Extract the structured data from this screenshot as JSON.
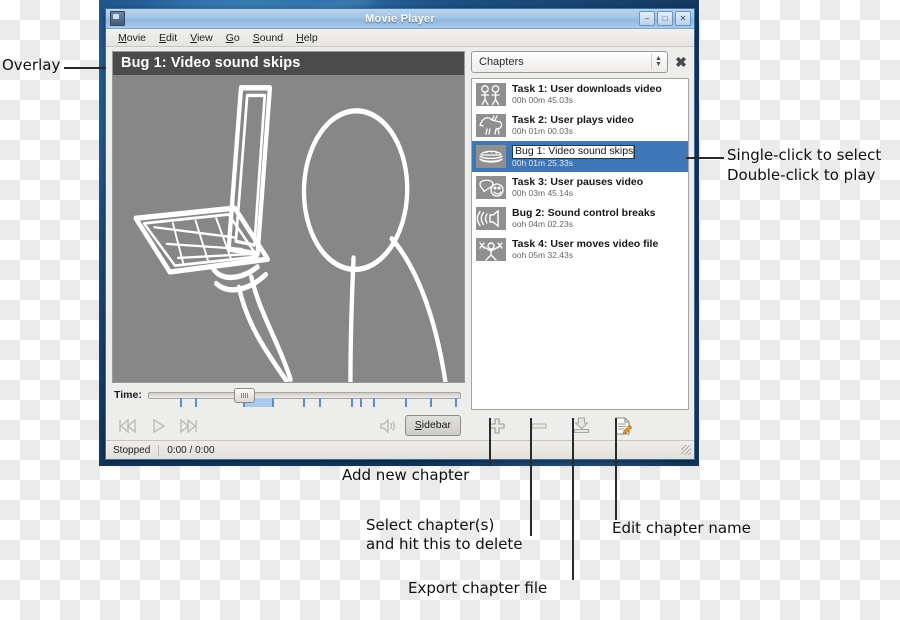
{
  "window": {
    "title": "Movie Player",
    "icon": "movie-player-icon",
    "buttons": {
      "minimize": "–",
      "maximize": "□",
      "close": "✕"
    }
  },
  "menubar": {
    "items": [
      {
        "label": "Movie",
        "mnemonic": "M"
      },
      {
        "label": "Edit",
        "mnemonic": "E"
      },
      {
        "label": "View",
        "mnemonic": "V"
      },
      {
        "label": "Go",
        "mnemonic": "G"
      },
      {
        "label": "Sound",
        "mnemonic": "S"
      },
      {
        "label": "Help",
        "mnemonic": "H"
      }
    ]
  },
  "video": {
    "overlay_title": "Bug 1: Video sound skips",
    "sketch_name": "person-holding-laptop-sketch",
    "background_color": "#878787",
    "overlay_color": "#4b4b4b"
  },
  "transport": {
    "time_label": "Time:",
    "slider_value_percent": 30,
    "fill_start_percent": 30,
    "fill_end_percent": 39,
    "tick_positions": [
      10,
      15,
      30,
      39,
      49,
      54,
      64,
      67,
      71,
      81,
      89,
      97
    ],
    "previous_label": "previous-chapter",
    "play_label": "play",
    "next_label": "next-chapter",
    "volume_label": "volume",
    "sidebar_button": "Sidebar",
    "sidebar_mnemonic": "S"
  },
  "sidebar": {
    "selector_value": "Chapters",
    "close_label": "✖",
    "chapters": [
      {
        "title": "Task 1: User downloads video",
        "time": "00h 00m 45.03s",
        "thumb": "two-stick-figures-sketch",
        "selected": false,
        "editing": false
      },
      {
        "title": "Task 2: User plays video",
        "time": "00h 01m 00.03s",
        "thumb": "horse-sketch",
        "selected": false,
        "editing": false
      },
      {
        "title": "Bug 1: Video sound skips",
        "time": "00h 01m 25.33s",
        "thumb": "hamburger-sketch",
        "selected": true,
        "editing": true
      },
      {
        "title": "Task 3: User pauses video",
        "time": "00h 03m 45.14s",
        "thumb": "speech-bubble-smiley-sketch",
        "selected": false,
        "editing": false
      },
      {
        "title": "Bug 2: Sound control breaks",
        "time": "ooh 04m 02.23s",
        "thumb": "speaker-sound-sketch",
        "selected": false,
        "editing": false
      },
      {
        "title": "Task 4: User moves video file",
        "time": "ooh 05m 32.43s",
        "thumb": "stick-figure-arms-sketch",
        "selected": false,
        "editing": false
      }
    ],
    "toolbar": [
      {
        "name": "add-chapter-button",
        "icon": "plus-icon"
      },
      {
        "name": "delete-chapter-button",
        "icon": "minus-icon"
      },
      {
        "name": "export-chapter-button",
        "icon": "download-tray-icon"
      },
      {
        "name": "edit-chapter-name-button",
        "icon": "document-pencil-icon"
      }
    ]
  },
  "statusbar": {
    "state": "Stopped",
    "time": "0:00 / 0:00"
  },
  "annotations": {
    "overlay": "Overlay",
    "click_hint_line1": "Single-click to select",
    "click_hint_line2": "Double-click to play",
    "add_chapter": "Add new chapter",
    "delete_line1": "Select chapter(s)",
    "delete_line2": "and hit this to delete",
    "export": "Export chapter file",
    "edit_name": "Edit chapter name"
  }
}
